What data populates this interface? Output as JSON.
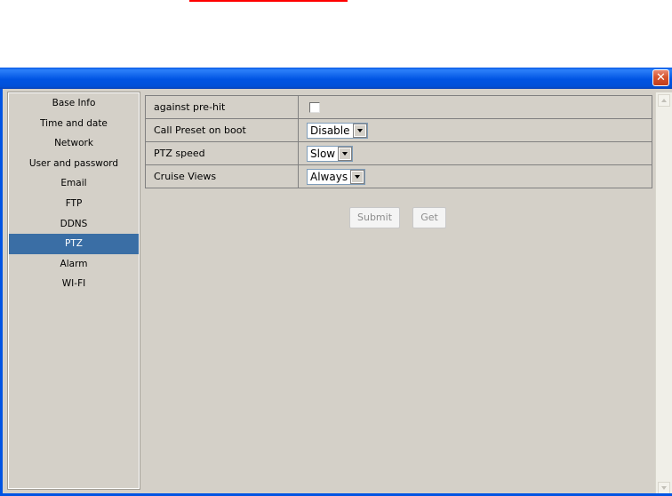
{
  "window": {
    "close_glyph": "✕"
  },
  "sidebar": {
    "items": [
      {
        "label": "Base Info"
      },
      {
        "label": "Time and date"
      },
      {
        "label": "Network"
      },
      {
        "label": "User and password"
      },
      {
        "label": "Email"
      },
      {
        "label": "FTP"
      },
      {
        "label": "DDNS"
      },
      {
        "label": "PTZ",
        "active": true
      },
      {
        "label": "Alarm"
      },
      {
        "label": "WI-FI"
      }
    ]
  },
  "ptz": {
    "rows": [
      {
        "label": "against pre-hit",
        "control": "checkbox",
        "checked": false
      },
      {
        "label": "Call Preset on boot",
        "control": "select",
        "value": "Disable"
      },
      {
        "label": "PTZ speed",
        "control": "select",
        "value": "Slow"
      },
      {
        "label": "Cruise Views",
        "control": "select",
        "value": "Always"
      }
    ],
    "submit_label": "Submit",
    "get_label": "Get"
  },
  "colors": {
    "titlebar": "#0054e3",
    "active_nav": "#3a6ea5",
    "window_bg": "#d4d0c8",
    "accent_red": "#ff0000"
  }
}
